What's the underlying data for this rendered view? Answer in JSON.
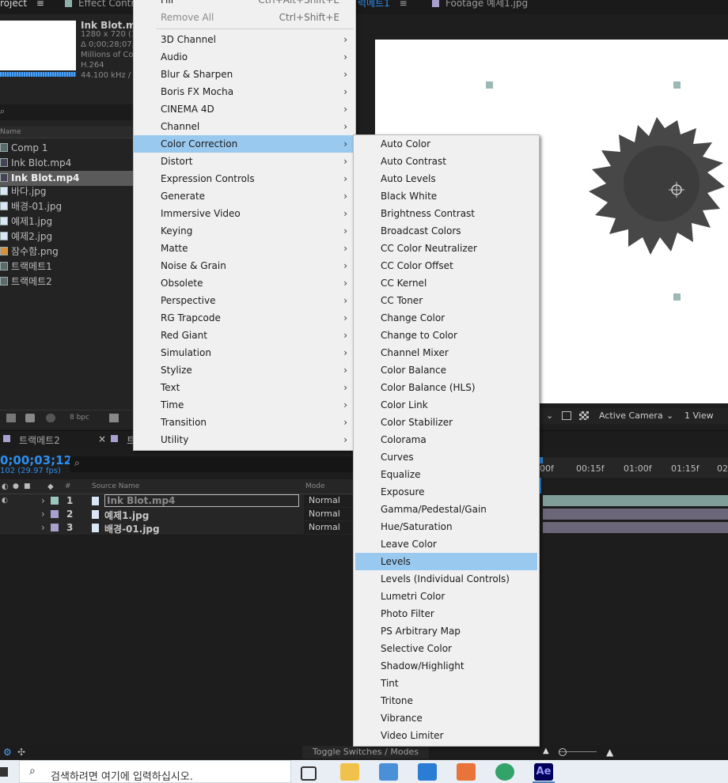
{
  "top_tabs": {
    "project": "roject",
    "effect_controls": "Effect Controls",
    "comp_tab": "럭메트1",
    "footage": "Footage 예제1.jpg"
  },
  "project": {
    "file_title": "Ink Blot.mp",
    "meta": [
      "1280 x 720 (1",
      "Δ 0;00;28;07,",
      "Millions of Co",
      "H.264",
      "44.100 kHz / 3"
    ],
    "column_name": "Name",
    "items": [
      {
        "label": "Comp 1",
        "selected": false
      },
      {
        "label": "Ink Blot.mp4",
        "selected": false
      },
      {
        "label": "Ink Blot.mp4",
        "selected": true
      },
      {
        "label": "바다.jpg",
        "selected": false
      },
      {
        "label": "배경-01.jpg",
        "selected": false
      },
      {
        "label": "예제1.jpg",
        "selected": false
      },
      {
        "label": "예제2.jpg",
        "selected": false
      },
      {
        "label": "잠수함.png",
        "selected": false
      },
      {
        "label": "트랙메트1",
        "selected": false
      },
      {
        "label": "트랙메트2",
        "selected": false
      }
    ],
    "bpc": "8 bpc"
  },
  "viewer": {
    "camera": "Active Camera",
    "views": "1 View"
  },
  "timeline": {
    "tab1": "트랙메트2",
    "close": "×",
    "tab2": "트",
    "timecode": "0;00;03;12",
    "fps": "102 (29.97 fps)",
    "col_source": "Source Name",
    "col_mode": "Mode",
    "col_hash": "#",
    "layers": [
      {
        "num": "1",
        "name": "Ink Blot.mp4",
        "mode": "Normal",
        "color": "#9cc5bd"
      },
      {
        "num": "2",
        "name": "예제1.jpg",
        "mode": "Normal",
        "color": "#a9a0cf"
      },
      {
        "num": "3",
        "name": "배경-01.jpg",
        "mode": "Normal",
        "color": "#a9a0cf"
      }
    ],
    "ruler": [
      "00f",
      "00:15f",
      "01:00f",
      "01:15f",
      "02"
    ],
    "toggle": "Toggle Switches / Modes"
  },
  "menu": {
    "items_top": [
      {
        "label": "Fill",
        "shortcut": "Ctrl+Alt+Shift+E",
        "disabled": false
      },
      {
        "label": "Remove All",
        "shortcut": "Ctrl+Shift+E",
        "disabled": true
      }
    ],
    "items": [
      "3D Channel",
      "Audio",
      "Blur & Sharpen",
      "Boris FX Mocha",
      "CINEMA 4D",
      "Channel",
      "Color Correction",
      "Distort",
      "Expression Controls",
      "Generate",
      "Immersive Video",
      "Keying",
      "Matte",
      "Noise & Grain",
      "Obsolete",
      "Perspective",
      "RG Trapcode",
      "Red Giant",
      "Simulation",
      "Stylize",
      "Text",
      "Time",
      "Transition",
      "Utility"
    ],
    "highlighted": "Color Correction",
    "arrow": "›"
  },
  "submenu": {
    "items": [
      "Auto Color",
      "Auto Contrast",
      "Auto Levels",
      "Black  White",
      "Brightness  Contrast",
      "Broadcast Colors",
      "CC Color Neutralizer",
      "CC Color Offset",
      "CC Kernel",
      "CC Toner",
      "Change Color",
      "Change to Color",
      "Channel Mixer",
      "Color Balance",
      "Color Balance (HLS)",
      "Color Link",
      "Color Stabilizer",
      "Colorama",
      "Curves",
      "Equalize",
      "Exposure",
      "Gamma/Pedestal/Gain",
      "Hue/Saturation",
      "Leave Color",
      "Levels",
      "Levels (Individual Controls)",
      "Lumetri Color",
      "Photo Filter",
      "PS Arbitrary Map",
      "Selective Color",
      "Shadow/Highlight",
      "Tint",
      "Tritone",
      "Vibrance",
      "Video Limiter"
    ],
    "highlighted": "Levels"
  },
  "taskbar": {
    "search_placeholder": "검색하려면 여기에 입력하십시오.",
    "apps": [
      "task-view",
      "file-explorer",
      "store",
      "mail",
      "media",
      "edge",
      "after-effects"
    ],
    "ae_label": "Ae"
  },
  "colors": {
    "highlight": "#99c9ef",
    "accent_blue": "#2b8ff1"
  }
}
